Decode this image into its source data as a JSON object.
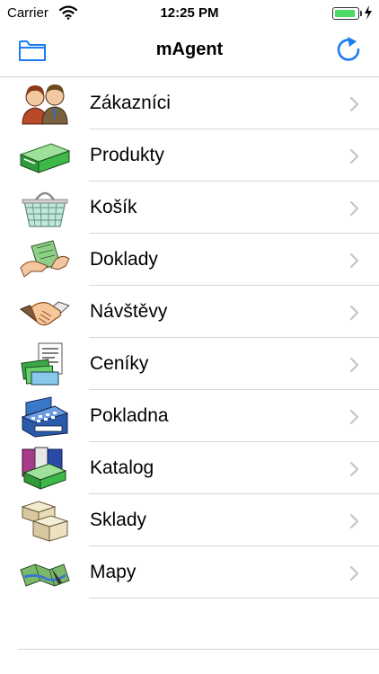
{
  "status_bar": {
    "carrier": "Carrier",
    "time": "12:25 PM",
    "battery_color": "#4cd964",
    "battery_level": 0.9
  },
  "nav": {
    "title": "mAgent",
    "left_icon": "folder-icon",
    "right_icon": "refresh-icon",
    "accent_color": "#1a7bf2"
  },
  "menu": {
    "items": [
      {
        "label": "Zákazníci",
        "icon": "customers-icon"
      },
      {
        "label": "Produkty",
        "icon": "products-icon"
      },
      {
        "label": "Košík",
        "icon": "basket-icon"
      },
      {
        "label": "Doklady",
        "icon": "documents-icon"
      },
      {
        "label": "Návštěvy",
        "icon": "handshake-icon"
      },
      {
        "label": "Ceníky",
        "icon": "price-list-icon"
      },
      {
        "label": "Pokladna",
        "icon": "cash-register-icon"
      },
      {
        "label": "Katalog",
        "icon": "catalog-icon"
      },
      {
        "label": "Sklady",
        "icon": "warehouse-boxes-icon"
      },
      {
        "label": "Mapy",
        "icon": "map-icon"
      }
    ]
  }
}
